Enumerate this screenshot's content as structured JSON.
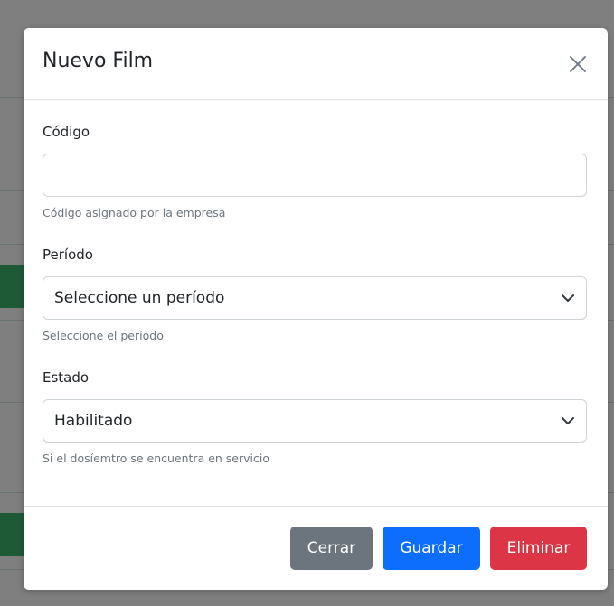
{
  "modal": {
    "title": "Nuevo Film"
  },
  "form": {
    "codigo": {
      "label": "Código",
      "value": "",
      "placeholder": "",
      "help": "Código asignado por la empresa"
    },
    "periodo": {
      "label": "Período",
      "selected": "Seleccione un período",
      "help": "Seleccione el período"
    },
    "estado": {
      "label": "Estado",
      "selected": "Habilitado",
      "help": "Si el dosíemtro se encuentra en servicio"
    }
  },
  "footer": {
    "close_label": "Cerrar",
    "save_label": "Guardar",
    "delete_label": "Eliminar"
  },
  "colors": {
    "primary": "#0d6efd",
    "secondary": "#6c757d",
    "danger": "#dc3545",
    "backdrop": "#7f7f7f"
  },
  "icons": {
    "close": "close-icon",
    "select_arrow": "chevron-down-icon"
  }
}
